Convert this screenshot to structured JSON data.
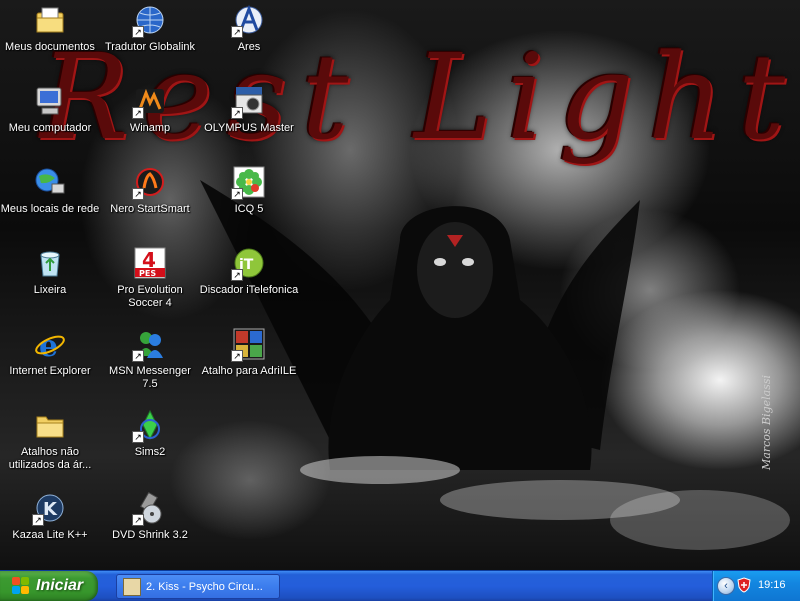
{
  "wallpaper": {
    "title": "Rest Light",
    "signature": "Marcos Bigelassi"
  },
  "desktop": {
    "icons": [
      {
        "label": "Meus documentos",
        "icon": "my-documents-icon"
      },
      {
        "label": "Tradutor Globalink",
        "icon": "globe-icon"
      },
      {
        "label": "Ares",
        "icon": "ares-icon"
      },
      {
        "label": "Meu computador",
        "icon": "my-computer-icon"
      },
      {
        "label": "Winamp",
        "icon": "winamp-icon"
      },
      {
        "label": "OLYMPUS Master",
        "icon": "olympus-camera-icon"
      },
      {
        "label": "Meus locais de rede",
        "icon": "network-places-icon"
      },
      {
        "label": "Nero StartSmart",
        "icon": "nero-icon"
      },
      {
        "label": "ICQ 5",
        "icon": "icq-flower-icon"
      },
      {
        "label": "Lixeira",
        "icon": "recycle-bin-icon"
      },
      {
        "label": "Pro Evolution Soccer 4",
        "icon": "pes4-icon"
      },
      {
        "label": "Discador iTelefonica",
        "icon": "itelefonica-dialer-icon"
      },
      {
        "label": "Internet Explorer",
        "icon": "internet-explorer-icon"
      },
      {
        "label": "MSN Messenger 7.5",
        "icon": "msn-messenger-icon"
      },
      {
        "label": "Atalho para AdriILE",
        "icon": "image-shortcut-icon"
      },
      {
        "label": "Atalhos não utilizados da ár...",
        "icon": "folder-icon"
      },
      {
        "label": "Sims2",
        "icon": "sims2-icon"
      },
      {
        "label": "Kazaa Lite K++",
        "icon": "kazaa-icon"
      },
      {
        "label": "DVD Shrink 3.2",
        "icon": "dvd-shrink-icon"
      }
    ]
  },
  "taskbar": {
    "start_label": "Iniciar",
    "task_label": "2. Kiss - Psycho Circu...",
    "task_icon": "winamp-task-icon",
    "clock": "19:16",
    "tray_icons": [
      "show-hidden-icons-icon",
      "security-shield-icon"
    ]
  },
  "colors": {
    "taskbar_blue": "#245edb",
    "start_green": "#3c9a31",
    "tray_blue": "#1386e0",
    "title_red": "#5a0a0a"
  }
}
